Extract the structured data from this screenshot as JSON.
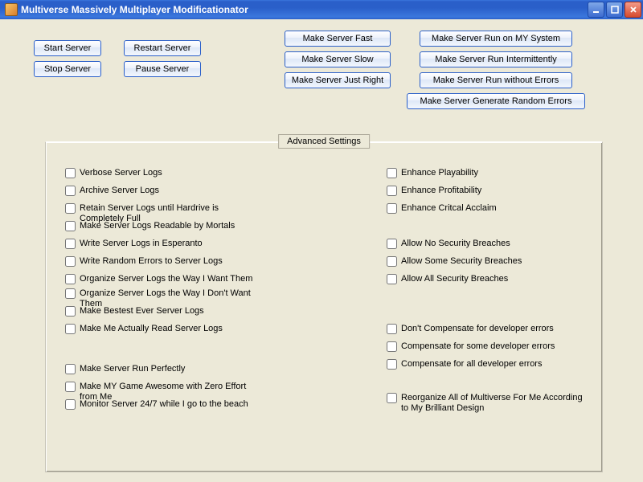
{
  "window": {
    "title": "Multiverse Massively Multiplayer Modificationator"
  },
  "buttons": {
    "start_server": "Start Server",
    "stop_server": "Stop Server",
    "restart_server": "Restart Server",
    "pause_server": "Pause Server",
    "make_fast": "Make Server Fast",
    "make_slow": "Make Server Slow",
    "make_just_right": "Make Server Just Right",
    "run_my_system": "Make Server Run on MY System",
    "run_intermittently": "Make Server Run Intermittently",
    "run_without_errors": "Make Server Run without Errors",
    "gen_random_errors": "Make Server Generate Random Errors"
  },
  "group": {
    "label": "Advanced Settings",
    "left_a": [
      "Verbose Server Logs",
      "Archive Server Logs",
      "Retain Server Logs until Hardrive is Completely Full",
      "Make Server Logs Readable by Mortals",
      "Write Server Logs in Esperanto",
      "Write Random Errors to Server Logs",
      "Organize Server Logs the Way I Want Them",
      "Organize Server Logs the Way I Don't Want Them",
      "Make Bestest Ever Server Logs",
      "Make Me Actually Read Server Logs"
    ],
    "left_b": [
      "Make Server Run Perfectly",
      "Make MY Game Awesome with Zero Effort from Me",
      "Monitor Server 24/7 while I go to the beach"
    ],
    "right_a": [
      "Enhance Playability",
      "Enhance Profitability",
      "Enhance Critcal Acclaim"
    ],
    "right_b": [
      "Allow No Security Breaches",
      "Allow Some Security Breaches",
      "Allow All Security Breaches"
    ],
    "right_c": [
      "Don't Compensate for developer errors",
      "Compensate for some developer errors",
      "Compensate for all developer errors"
    ],
    "right_d": [
      "Reorganize All of Multiverse For Me According to My Brilliant Design"
    ]
  }
}
